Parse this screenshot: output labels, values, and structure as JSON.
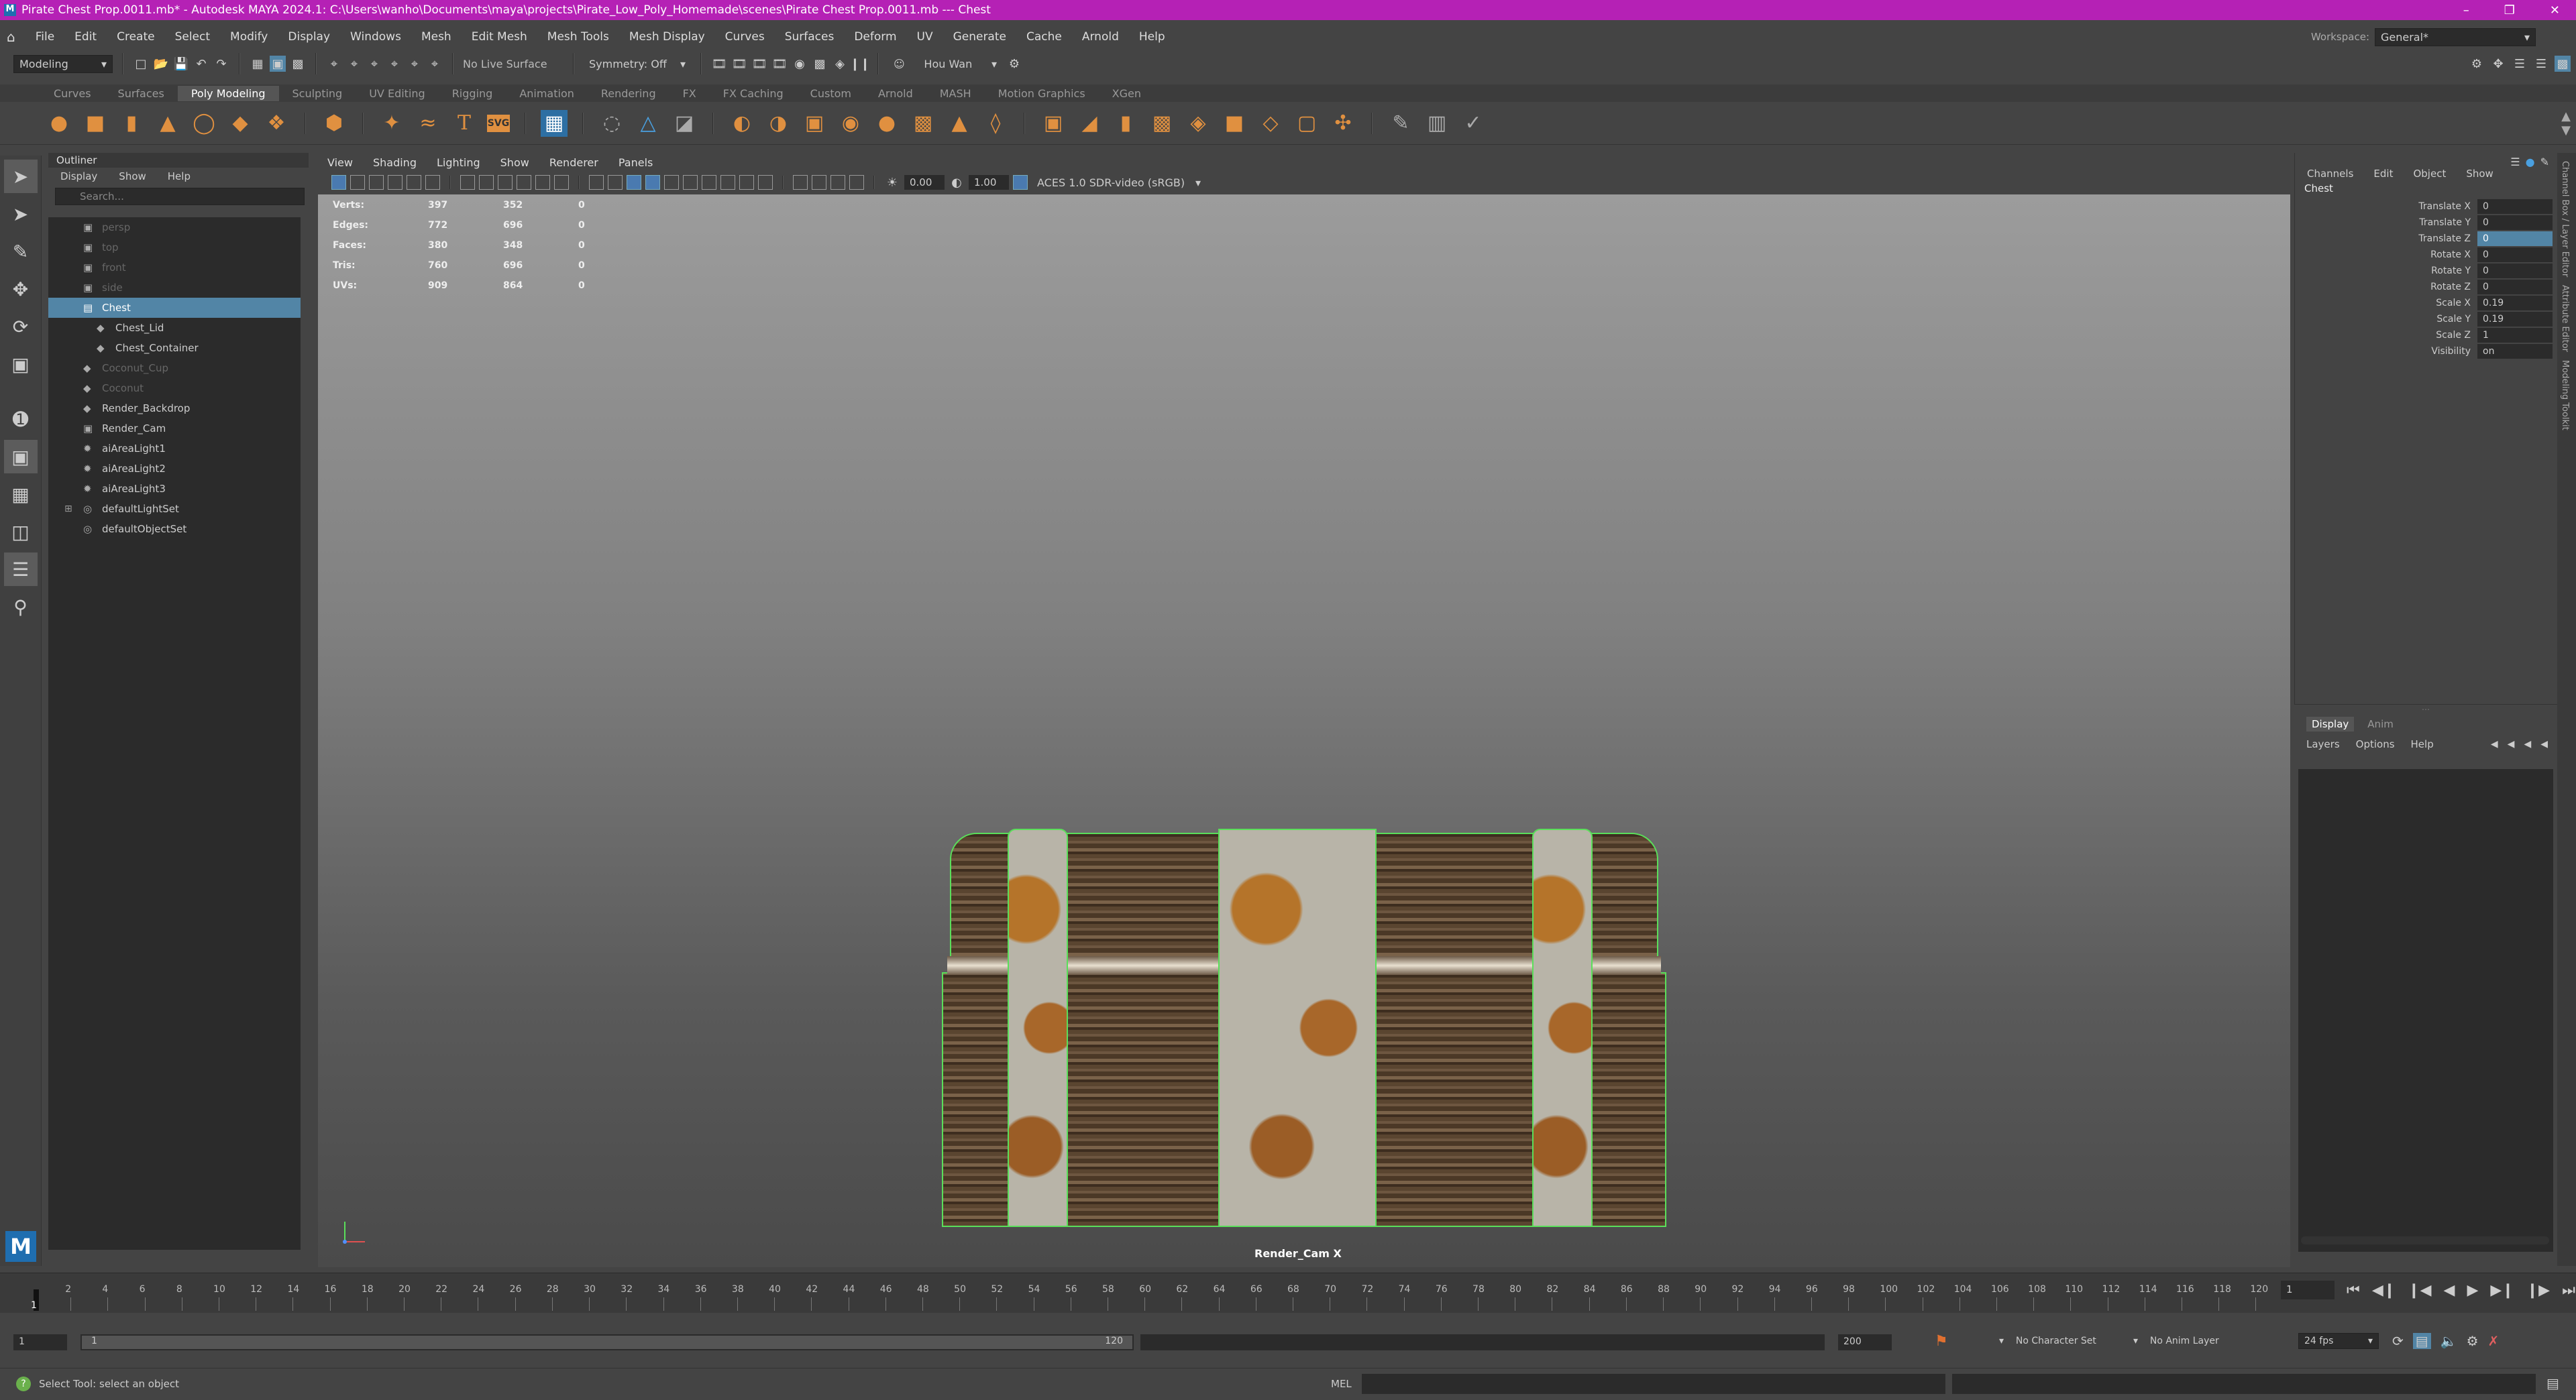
{
  "window": {
    "title": "Pirate Chest Prop.0011.mb* - Autodesk MAYA 2024.1: C:\\Users\\wanho\\Documents\\maya\\projects\\Pirate_Low_Poly_Homemade\\scenes\\Pirate Chest Prop.0011.mb  ---  Chest"
  },
  "menubar": {
    "items": [
      "File",
      "Edit",
      "Create",
      "Select",
      "Modify",
      "Display",
      "Windows",
      "Mesh",
      "Edit Mesh",
      "Mesh Tools",
      "Mesh Display",
      "Curves",
      "Surfaces",
      "Deform",
      "UV",
      "Generate",
      "Cache",
      "Arnold",
      "Help"
    ],
    "workspace_label": "Workspace:",
    "workspace_value": "General*"
  },
  "statusline": {
    "mode": "Modeling",
    "live_surface": "No Live Surface",
    "symmetry": "Symmetry: Off",
    "user": "Hou Wan"
  },
  "shelf": {
    "tabs": [
      "Curves",
      "Surfaces",
      "Poly Modeling",
      "Sculpting",
      "UV Editing",
      "Rigging",
      "Animation",
      "Rendering",
      "FX",
      "FX Caching",
      "Custom",
      "Arnold",
      "MASH",
      "Motion Graphics",
      "XGen"
    ],
    "active_tab": "Poly Modeling",
    "svg_label": "SVG"
  },
  "outliner": {
    "title": "Outliner",
    "menu": [
      "Display",
      "Show",
      "Help"
    ],
    "search_placeholder": "Search...",
    "items": [
      {
        "label": "persp",
        "icon": "camera-icon",
        "dim": true,
        "indent": 0
      },
      {
        "label": "top",
        "icon": "camera-icon",
        "dim": true,
        "indent": 0
      },
      {
        "label": "front",
        "icon": "camera-icon",
        "dim": true,
        "indent": 0
      },
      {
        "label": "side",
        "icon": "camera-icon",
        "dim": true,
        "indent": 0
      },
      {
        "label": "Chest",
        "icon": "group-icon",
        "dim": false,
        "indent": 0,
        "selected": true
      },
      {
        "label": "Chest_Lid",
        "icon": "mesh-icon",
        "dim": false,
        "indent": 1
      },
      {
        "label": "Chest_Container",
        "icon": "mesh-icon",
        "dim": false,
        "indent": 1
      },
      {
        "label": "Coconut_Cup",
        "icon": "mesh-icon",
        "dim": true,
        "indent": 0
      },
      {
        "label": "Coconut",
        "icon": "mesh-icon",
        "dim": true,
        "indent": 0
      },
      {
        "label": "Render_Backdrop",
        "icon": "mesh-icon",
        "dim": false,
        "indent": 0
      },
      {
        "label": "Render_Cam",
        "icon": "camera-icon",
        "dim": false,
        "indent": 0
      },
      {
        "label": "aiAreaLight1",
        "icon": "light-icon",
        "dim": false,
        "indent": 0
      },
      {
        "label": "aiAreaLight2",
        "icon": "light-icon",
        "dim": false,
        "indent": 0
      },
      {
        "label": "aiAreaLight3",
        "icon": "light-icon",
        "dim": false,
        "indent": 0
      },
      {
        "label": "defaultLightSet",
        "icon": "set-icon",
        "dim": false,
        "indent": 0,
        "expandable": true
      },
      {
        "label": "defaultObjectSet",
        "icon": "set-icon",
        "dim": false,
        "indent": 0
      }
    ]
  },
  "viewport": {
    "menu": [
      "View",
      "Shading",
      "Lighting",
      "Show",
      "Renderer",
      "Panels"
    ],
    "exposure": "0.00",
    "gamma": "1.00",
    "color_space": "ACES 1.0 SDR-video (sRGB)",
    "camera_name": "Render_Cam X",
    "hud": [
      {
        "label": "Verts:",
        "a": "397",
        "b": "352",
        "c": "0"
      },
      {
        "label": "Edges:",
        "a": "772",
        "b": "696",
        "c": "0"
      },
      {
        "label": "Faces:",
        "a": "380",
        "b": "348",
        "c": "0"
      },
      {
        "label": "Tris:",
        "a": "760",
        "b": "696",
        "c": "0"
      },
      {
        "label": "UVs:",
        "a": "909",
        "b": "864",
        "c": "0"
      }
    ]
  },
  "channelbox": {
    "menu": [
      "Channels",
      "Edit",
      "Object",
      "Show"
    ],
    "object": "Chest",
    "attrs": [
      {
        "name": "Translate X",
        "value": "0"
      },
      {
        "name": "Translate Y",
        "value": "0"
      },
      {
        "name": "Translate Z",
        "value": "0",
        "highlight": true
      },
      {
        "name": "Rotate X",
        "value": "0"
      },
      {
        "name": "Rotate Y",
        "value": "0"
      },
      {
        "name": "Rotate Z",
        "value": "0"
      },
      {
        "name": "Scale X",
        "value": "0.19"
      },
      {
        "name": "Scale Y",
        "value": "0.19"
      },
      {
        "name": "Scale Z",
        "value": "1"
      },
      {
        "name": "Visibility",
        "value": "on"
      }
    ],
    "side_tabs": [
      "Channel Box / Layer Editor",
      "Attribute Editor",
      "Modeling Toolkit"
    ]
  },
  "layer_editor": {
    "tabs": [
      "Display",
      "Anim"
    ],
    "menu": [
      "Layers",
      "Options",
      "Help"
    ]
  },
  "timeline": {
    "ticks": [
      "2",
      "4",
      "6",
      "8",
      "10",
      "12",
      "14",
      "16",
      "18",
      "20",
      "22",
      "24",
      "26",
      "28",
      "30",
      "32",
      "34",
      "36",
      "38",
      "40",
      "42",
      "44",
      "46",
      "48",
      "50",
      "52",
      "54",
      "56",
      "58",
      "60",
      "62",
      "64",
      "66",
      "68",
      "70",
      "72",
      "74",
      "76",
      "78",
      "80",
      "82",
      "84",
      "86",
      "88",
      "90",
      "92",
      "94",
      "96",
      "98",
      "100",
      "102",
      "104",
      "106",
      "108",
      "110",
      "112",
      "114",
      "116",
      "118",
      "120"
    ],
    "current_frame": "1",
    "start_label": "1"
  },
  "range": {
    "start": "1",
    "inner_start": "1",
    "inner_end": "120",
    "end": "200",
    "character_set": "No Character Set",
    "anim_layer": "No Anim Layer",
    "fps": "24 fps"
  },
  "cmdline": {
    "help_text": "Select Tool: select an object",
    "mel_label": "MEL"
  },
  "colors": {
    "title_bar": "#b521b5",
    "selection": "#5285a6",
    "shelf_icon": "#e09040"
  }
}
